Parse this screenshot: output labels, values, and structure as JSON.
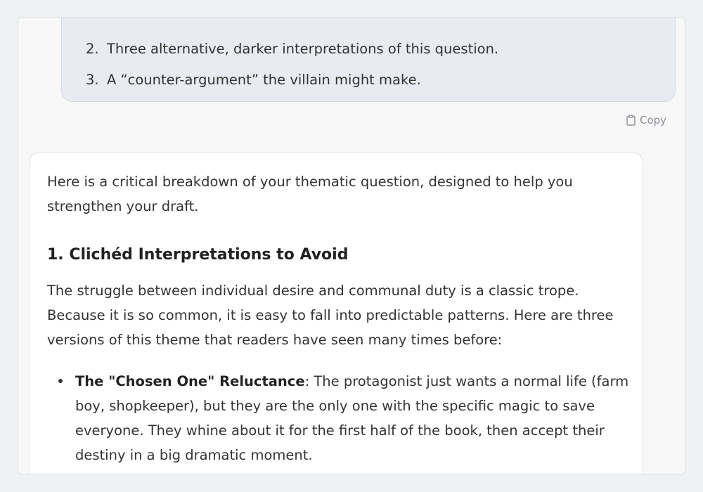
{
  "user_message": {
    "list_items": [
      {
        "number": "2.",
        "text": "Three alternative, darker interpretations of this question."
      },
      {
        "number": "3.",
        "text": "A “counter-argument” the villain might make."
      }
    ]
  },
  "copy_button": {
    "label": "Copy",
    "icon": "clipboard-icon"
  },
  "assistant_message": {
    "intro": "Here is a critical breakdown of your thematic question, designed to help you strengthen your draft.",
    "section_heading": "1. Clichéd Interpretations to Avoid",
    "section_paragraph": "The struggle between individual desire and communal duty is a classic trope. Because it is so common, it is easy to fall into predictable patterns. Here are three versions of this theme that readers have seen many times before:",
    "bullets": [
      {
        "title": "The \"Chosen One\" Reluctance",
        "text": ": The protagonist just wants a normal life (farm boy, shopkeeper), but they are the only one with the specific magic to save everyone. They whine about it for the first half of the book, then accept their destiny in a big dramatic moment."
      }
    ]
  }
}
